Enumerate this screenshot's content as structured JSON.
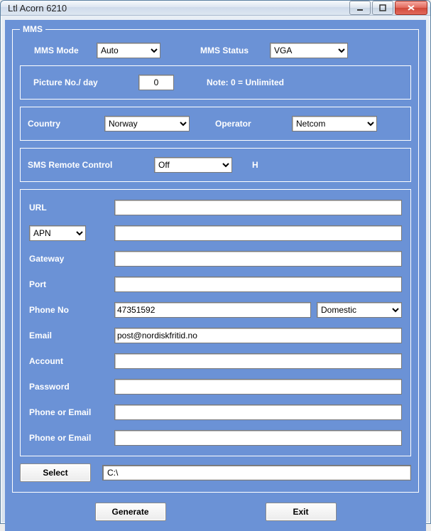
{
  "window": {
    "title": "Ltl Acorn 6210"
  },
  "mms": {
    "legend": "MMS",
    "mode_label": "MMS Mode",
    "mode_value": "Auto",
    "status_label": "MMS Status",
    "status_value": "VGA",
    "picture_label": "Picture No./ day",
    "picture_value": "0",
    "picture_note": "Note: 0 = Unlimited",
    "country_label": "Country",
    "country_value": "Norway",
    "operator_label": "Operator",
    "operator_value": "Netcom",
    "sms_label": "SMS Remote Control",
    "sms_value": "Off",
    "sms_suffix": "H"
  },
  "fields": {
    "url_label": "URL",
    "url": "",
    "apn_select": "APN",
    "apn": "",
    "gateway_label": "Gateway",
    "gateway": "",
    "port_label": "Port",
    "port": "",
    "phone_label": "Phone No",
    "phone": "47351592",
    "phone_type": "Domestic",
    "email_label": "Email",
    "email": "post@nordiskfritid.no",
    "account_label": "Account",
    "account": "",
    "password_label": "Password",
    "password": "",
    "extra1_label": "Phone or Email",
    "extra1": "",
    "extra2_label": "Phone or Email",
    "extra2": ""
  },
  "footer": {
    "select_btn": "Select",
    "path": "C:\\",
    "generate_btn": "Generate",
    "exit_btn": "Exit"
  }
}
